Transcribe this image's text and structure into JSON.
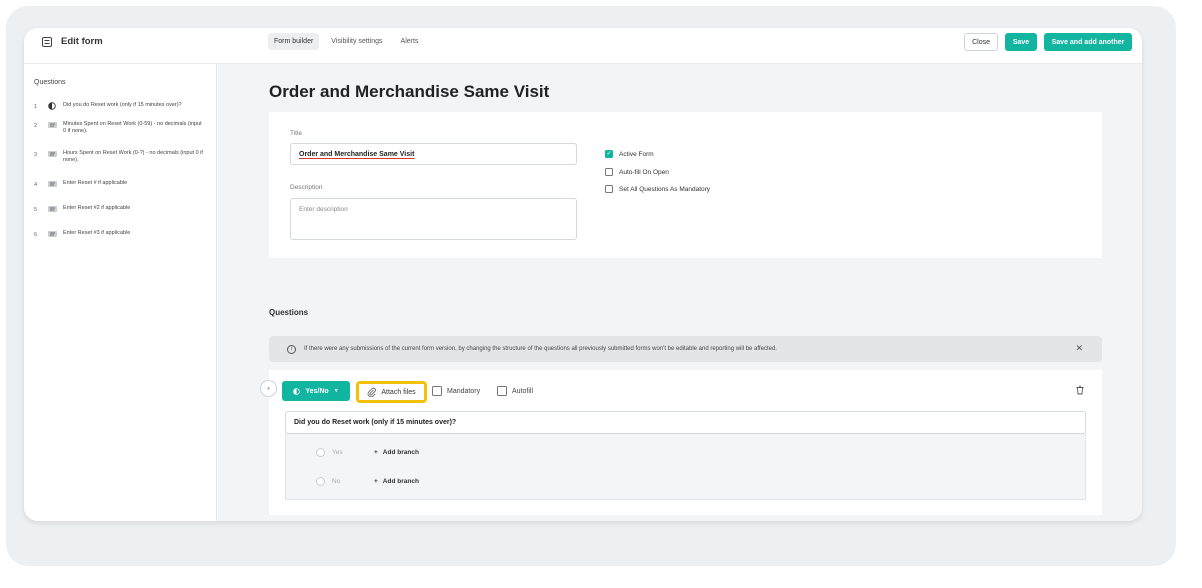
{
  "header": {
    "title": "Edit form",
    "tabs": [
      "Form builder",
      "Visibility settings",
      "Alerts"
    ],
    "active_tab": "Form builder",
    "close_label": "Close",
    "save_label": "Save",
    "save_add_label": "Save and add another"
  },
  "sidebar": {
    "title": "Questions",
    "items": [
      {
        "num": "1",
        "icon": "yes-no-icon",
        "text": "Did you do Reset work (only if 15 minutes over)?"
      },
      {
        "num": "2",
        "icon": "text-lines-icon",
        "text": "Minutes Spent on Reset Work (0-59) - no decimals (input 0 if none)."
      },
      {
        "num": "3",
        "icon": "text-lines-icon",
        "text": "Hours Spent on Reset Work (0-?) - no decimals (input 0 if none)."
      },
      {
        "num": "4",
        "icon": "text-lines-icon",
        "text": "Enter Reset # if applicable"
      },
      {
        "num": "5",
        "icon": "text-lines-icon",
        "text": "Enter Reset #2 if applicable"
      },
      {
        "num": "6",
        "icon": "text-lines-icon",
        "text": "Enter Reset #3 if applicable"
      }
    ]
  },
  "main": {
    "heading": "Order and Merchandise Same Visit",
    "title_label": "Title",
    "title_value": "Order and Merchandise Same Visit",
    "description_label": "Description",
    "description_placeholder": "Enter description",
    "options": [
      {
        "label": "Active Form",
        "checked": true
      },
      {
        "label": "Auto-fill On Open",
        "checked": false
      },
      {
        "label": "Set All Questions As Mandatory",
        "checked": false
      }
    ],
    "questions_heading": "Questions",
    "banner_text": "If there were any submissions of the current form version, by changing the structure of the questions all previously submitted forms won't be editable and reporting will be affected.",
    "question": {
      "type_label": "Yes/No",
      "attach_label": "Attach files",
      "mandatory_label": "Mandatory",
      "autofill_label": "Autofill",
      "text": "Did you do Reset work (only if 15 minutes over)?",
      "answers": [
        "Yes",
        "No"
      ],
      "add_branch_label": "Add branch"
    }
  },
  "colors": {
    "accent": "#11b5a0",
    "highlight": "#f5c108"
  }
}
